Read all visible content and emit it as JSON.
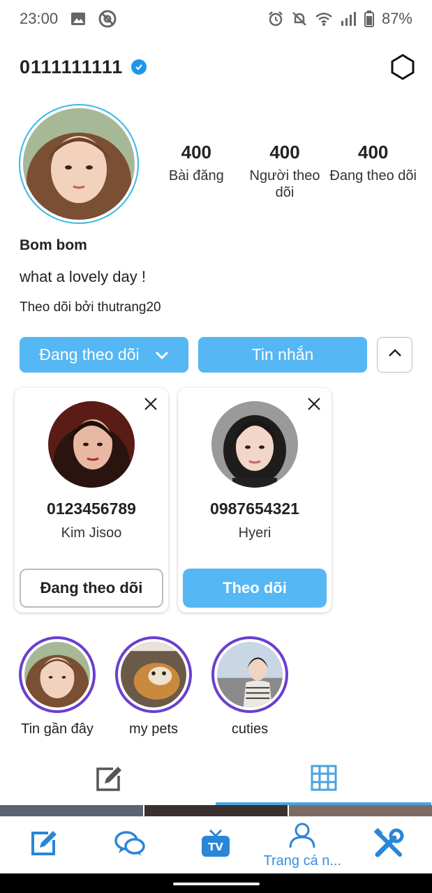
{
  "status_bar": {
    "time": "23:00",
    "battery": "87%"
  },
  "header": {
    "username": "0111111111"
  },
  "profile": {
    "full_name": "Bom bom",
    "bio": "what a lovely day !",
    "followed_by": "Theo dõi bởi thutrang20",
    "stats": [
      {
        "num": "400",
        "label": "Bài đăng"
      },
      {
        "num": "400",
        "label": "Người theo dõi"
      },
      {
        "num": "400",
        "label": "Đang theo dõi"
      }
    ]
  },
  "actions": {
    "following": "Đang theo dõi",
    "message": "Tin nhắn"
  },
  "suggestions": [
    {
      "name": "0123456789",
      "sub": "Kim Jisoo",
      "button": "Đang theo dõi"
    },
    {
      "name": "0987654321",
      "sub": "Hyeri",
      "button": "Theo dõi"
    }
  ],
  "highlights": [
    {
      "label": "Tin gần đây"
    },
    {
      "label": "my pets"
    },
    {
      "label": "cuties"
    }
  ],
  "bottom_nav": {
    "active_label": "Trang cá n..."
  },
  "colors": {
    "accent": "#55b7f3",
    "verified": "#1e96e8",
    "highlight_ring": "#6a3fcf",
    "nav": "#3b8ee0"
  }
}
